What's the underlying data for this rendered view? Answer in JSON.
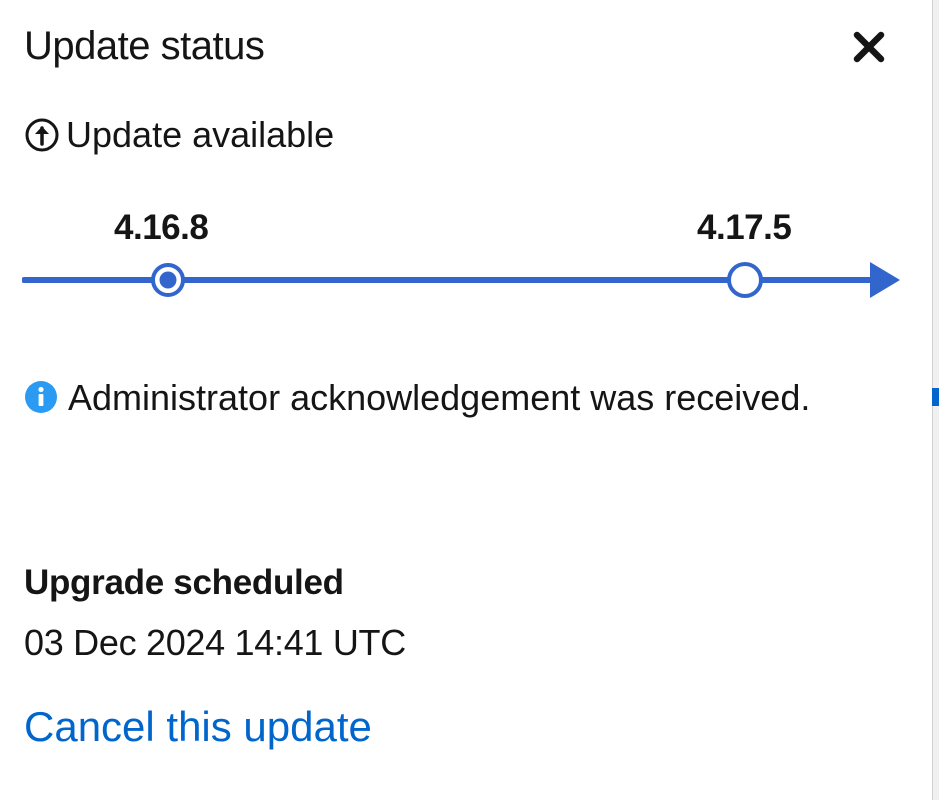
{
  "panel": {
    "title": "Update status",
    "close_icon": "close-icon"
  },
  "status": {
    "icon": "arrow-circle-up-icon",
    "text": "Update available"
  },
  "timeline": {
    "current_version": "4.16.8",
    "target_version": "4.17.5",
    "line_color": "#3366cc"
  },
  "info": {
    "icon": "info-circle-icon",
    "icon_color": "#2b9af3",
    "message": "Administrator acknowledgement was received."
  },
  "schedule": {
    "title": "Upgrade scheduled",
    "time": "03 Dec 2024 14:41 UTC"
  },
  "actions": {
    "cancel_label": "Cancel this update",
    "link_color": "#0066cc"
  }
}
